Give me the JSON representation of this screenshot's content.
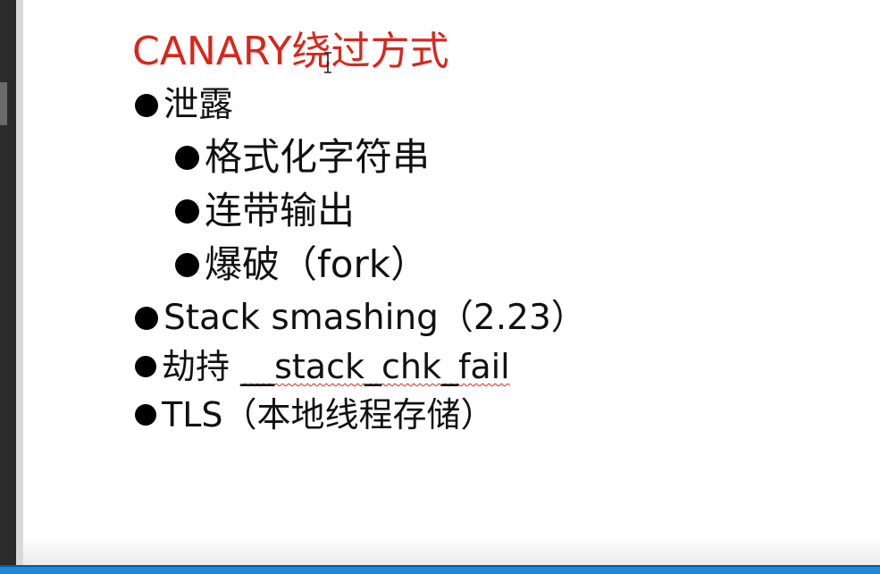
{
  "slide": {
    "title": "CANARY绕过方式",
    "colors": {
      "title": "#d9261c",
      "text": "#111111",
      "taskbar": "#1e88d6"
    },
    "items": [
      {
        "level": 1,
        "text": "泄露"
      },
      {
        "level": 2,
        "text": "格式化字符串"
      },
      {
        "level": 2,
        "text": "连带输出"
      },
      {
        "level": 2,
        "text": "爆破（fork）"
      },
      {
        "level": 1,
        "text": "Stack smashing（2.23）"
      },
      {
        "level": 1,
        "prefix": "劫持 ",
        "text": "__stack_chk_fail"
      },
      {
        "level": 1,
        "text": "TLS（本地线程存储）"
      }
    ]
  }
}
